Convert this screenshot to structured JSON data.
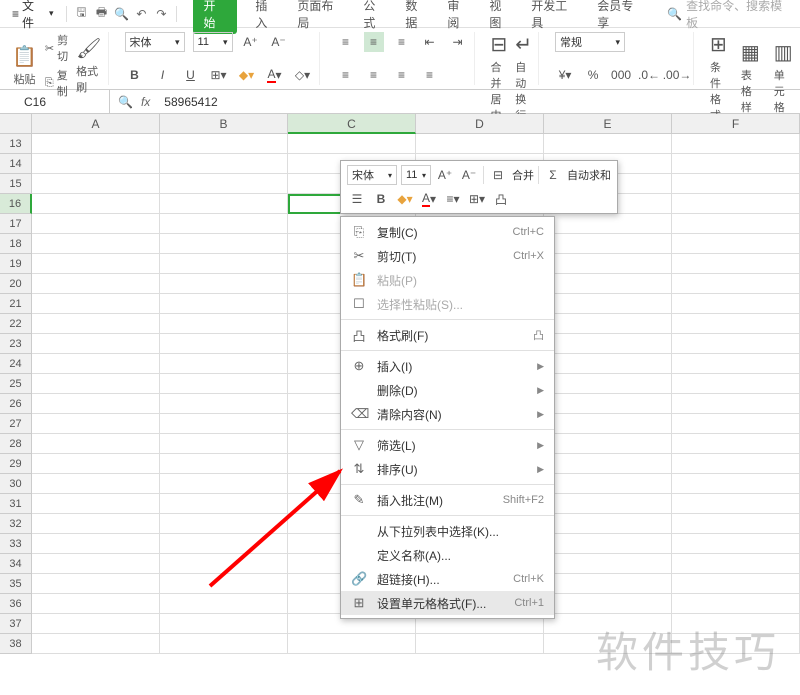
{
  "menubar": {
    "file": "文件",
    "search_placeholder": "查找命令、搜索模板",
    "tabs": [
      "开始",
      "插入",
      "页面布局",
      "公式",
      "数据",
      "审阅",
      "视图",
      "开发工具",
      "会员专享"
    ]
  },
  "ribbon": {
    "paste": "粘贴",
    "cut": "剪切",
    "copy": "复制",
    "format_painter": "格式刷",
    "font_name": "宋体",
    "font_size": "11",
    "merge": "合并居中",
    "wrap": "自动换行",
    "number_format": "常规",
    "cond_format": "条件格式",
    "table_style": "表格样",
    "cell_style": "单元格"
  },
  "formula_bar": {
    "cell_ref": "C16",
    "value": "58965412"
  },
  "grid": {
    "cols": [
      "A",
      "B",
      "C",
      "D",
      "E",
      "F"
    ],
    "rows": [
      13,
      14,
      15,
      16,
      17,
      18,
      19,
      20,
      21,
      22,
      23,
      24,
      25,
      26,
      27,
      28,
      29,
      30,
      31,
      32,
      33,
      34,
      35,
      36,
      37,
      38
    ],
    "active_col": "C",
    "active_row": 16,
    "cell_value": "58965412"
  },
  "mini_toolbar": {
    "font": "宋体",
    "size": "11",
    "merge": "合并",
    "autosum": "自动求和"
  },
  "context_menu": {
    "items": [
      {
        "icon": "⎘",
        "label": "复制(C)",
        "shortcut": "Ctrl+C"
      },
      {
        "icon": "✂",
        "label": "剪切(T)",
        "shortcut": "Ctrl+X"
      },
      {
        "icon": "📋",
        "label": "粘贴(P)",
        "disabled": true
      },
      {
        "icon": "☐",
        "label": "选择性粘贴(S)...",
        "disabled": true
      },
      {
        "sep": true
      },
      {
        "icon": "凸",
        "label": "格式刷(F)",
        "extra_icon": "凸"
      },
      {
        "sep": true
      },
      {
        "icon": "⊕",
        "label": "插入(I)",
        "arrow": true
      },
      {
        "icon": "",
        "label": "删除(D)",
        "arrow": true
      },
      {
        "icon": "⌫",
        "label": "清除内容(N)",
        "arrow": true
      },
      {
        "sep": true
      },
      {
        "icon": "▽",
        "label": "筛选(L)",
        "arrow": true
      },
      {
        "icon": "⇅",
        "label": "排序(U)",
        "arrow": true
      },
      {
        "sep": true
      },
      {
        "icon": "✎",
        "label": "插入批注(M)",
        "shortcut": "Shift+F2"
      },
      {
        "sep": true
      },
      {
        "icon": "",
        "label": "从下拉列表中选择(K)..."
      },
      {
        "icon": "",
        "label": "定义名称(A)..."
      },
      {
        "icon": "🔗",
        "label": "超链接(H)...",
        "shortcut": "Ctrl+K"
      },
      {
        "icon": "⊞",
        "label": "设置单元格格式(F)...",
        "shortcut": "Ctrl+1",
        "hover": true
      }
    ]
  },
  "watermark": "软件技巧"
}
